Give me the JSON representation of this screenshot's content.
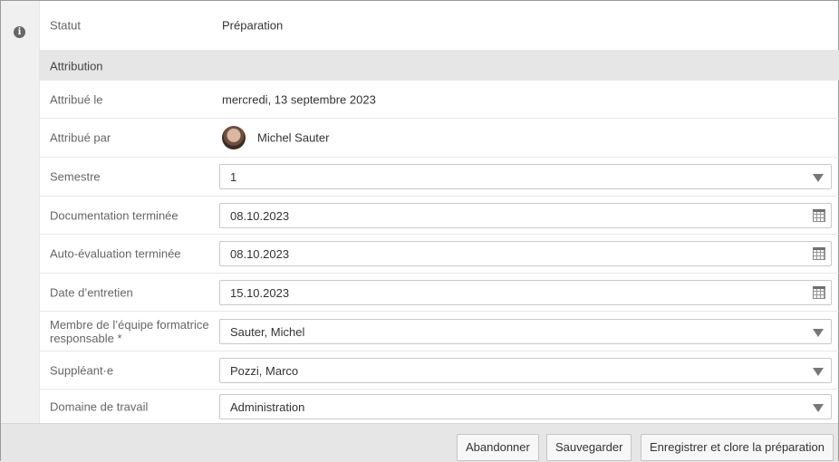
{
  "status": {
    "label": "Statut",
    "value": "Préparation"
  },
  "section": {
    "title": "Attribution"
  },
  "assigned_on": {
    "label": "Attribué le",
    "value": "mercredi, 13 septembre 2023"
  },
  "assigned_by": {
    "label": "Attribué par",
    "name": "Michel Sauter"
  },
  "semester": {
    "label": "Semestre",
    "value": "1"
  },
  "documentation_done": {
    "label": "Documentation terminée",
    "value": "08.10.2023"
  },
  "self_evaluation_done": {
    "label": "Auto-évaluation terminée",
    "value": "08.10.2023"
  },
  "interview_date": {
    "label": "Date d’entretien",
    "value": "15.10.2023"
  },
  "responsible_member": {
    "label": "Membre de l’équipe formatrice responsable *",
    "value": "Sauter, Michel"
  },
  "substitute": {
    "label": "Suppléant·e",
    "value": "Pozzi, Marco"
  },
  "work_domain": {
    "label": "Domaine de travail",
    "value": "Administration"
  },
  "footer": {
    "cancel_label": "Abandonner",
    "save_label": "Sauvegarder",
    "save_close_label": "Enregistrer et clore la préparation"
  }
}
